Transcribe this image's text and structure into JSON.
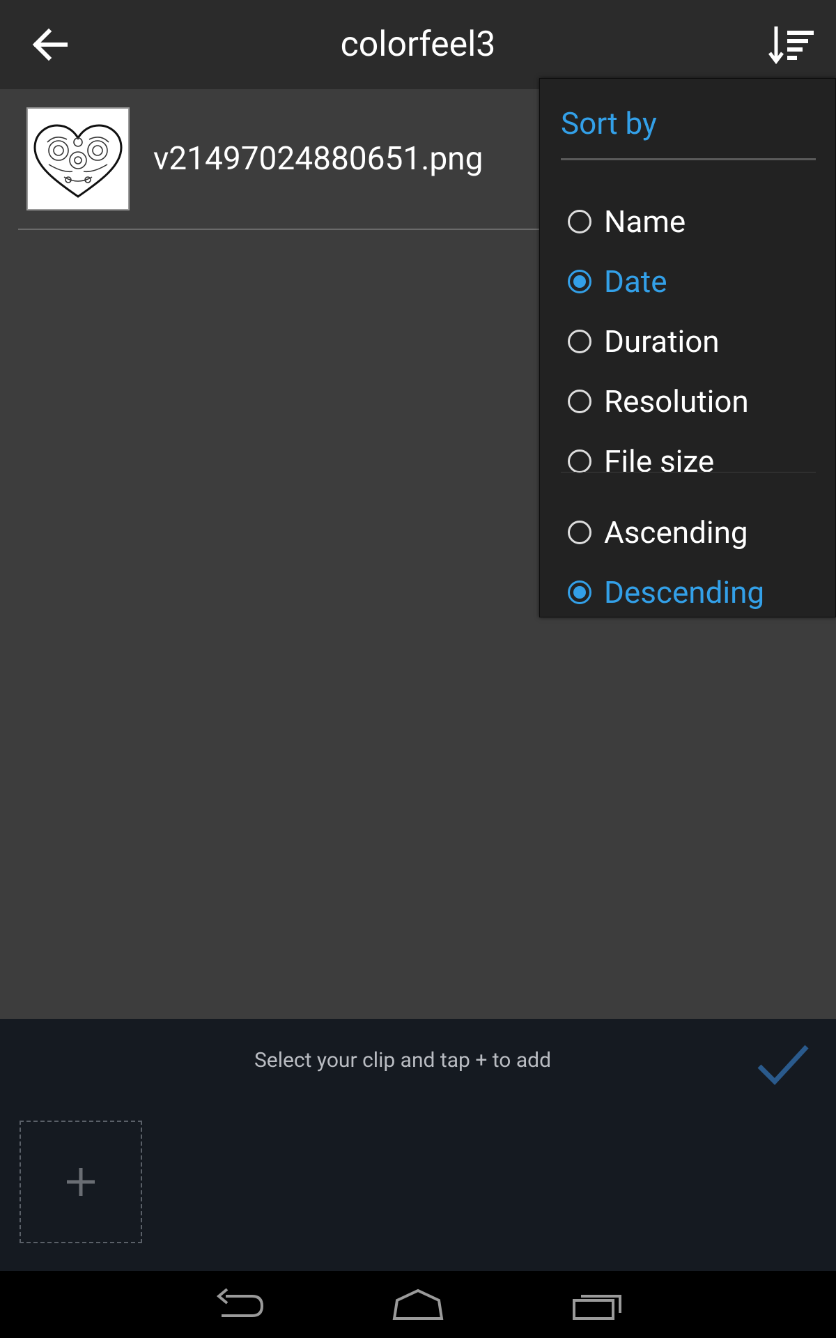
{
  "appbar": {
    "title": "colorfeel3",
    "back_icon": "arrow-back-icon",
    "sort_icon": "sort-icon"
  },
  "files": [
    {
      "name": "v21497024880651.png",
      "thumbnail": "heart-mandala-thumbnail"
    }
  ],
  "sort_menu": {
    "header": "Sort by",
    "sort_options": [
      {
        "label": "Name",
        "selected": false
      },
      {
        "label": "Date",
        "selected": true
      },
      {
        "label": "Duration",
        "selected": false
      },
      {
        "label": "Resolution",
        "selected": false
      },
      {
        "label": "File size",
        "selected": false
      }
    ],
    "order_options": [
      {
        "label": "Ascending",
        "selected": false
      },
      {
        "label": "Descending",
        "selected": true
      }
    ]
  },
  "clip_panel": {
    "hint": "Select your clip and tap + to add",
    "done_icon": "checkmark-icon",
    "add_icon": "plus-icon"
  },
  "navbar": {
    "buttons": [
      "back-nav-icon",
      "home-icon",
      "recents-icon"
    ]
  },
  "colors": {
    "accent": "#33a0e8",
    "background": "#3d3d3d",
    "appbar": "#2b2b2b",
    "menu": "#222222",
    "panel": "#151a21"
  }
}
